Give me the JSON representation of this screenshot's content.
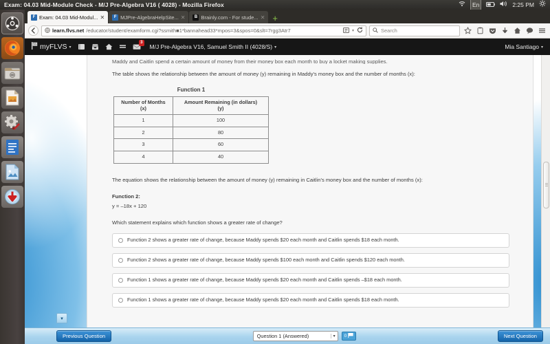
{
  "os": {
    "window_title": "Exam: 04.03 Mid-Module Check - M/J Pre-Algebra V16 ( 4028) - Mozilla Firefox",
    "tray": {
      "wifi_icon": "wifi-icon",
      "keyboard_layout": "En",
      "battery_icon": "battery-icon",
      "volume_icon": "volume-icon",
      "clock": "2:25 PM",
      "settings_icon": "gear-icon"
    },
    "launcher": [
      {
        "name": "ubuntu-dash-icon",
        "label": "Ubuntu Dash"
      },
      {
        "name": "firefox-icon",
        "label": "Firefox"
      },
      {
        "name": "files-icon",
        "label": "Files"
      },
      {
        "name": "impress-icon",
        "label": "LibreOffice Impress"
      },
      {
        "name": "system-settings-icon",
        "label": "System Settings"
      },
      {
        "name": "writer-icon",
        "label": "LibreOffice Writer"
      },
      {
        "name": "image-viewer-icon",
        "label": "Image Viewer"
      },
      {
        "name": "software-updater-icon",
        "label": "Software Updater"
      }
    ]
  },
  "browser": {
    "tabs": [
      {
        "title": "Exam: 04.03 Mid-Modul...",
        "favicon": "flvs",
        "active": true
      },
      {
        "title": "MJPre-AlgebraHelpSite...",
        "favicon": "flvs",
        "active": false
      },
      {
        "title": "Brainly.com - For stude...",
        "favicon": "brainly",
        "active": false
      }
    ],
    "new_tab_label": "+",
    "close_label": "✕",
    "url_host": "learn.flvs.net",
    "url_host_bold": "flvs.net",
    "url_path": "/educator/student/examform.cgi?ssmith■1*bannahead33*mpos=3&spos=0&slt=7rgg3Atr7",
    "search_placeholder": "Search",
    "toolbar_icons": [
      "bookmark-star-icon",
      "reader-clipboard-icon",
      "pocket-icon",
      "downloads-icon",
      "home-icon",
      "chat-icon",
      "menu-hamburger-icon"
    ]
  },
  "flvs": {
    "logo_text": "myFLVS",
    "nav_icons": [
      "book-icon",
      "inbox-icon",
      "home-icon",
      "list-icon",
      "mail-icon"
    ],
    "mail_badge": "3",
    "course_title": "M/J Pre-Algebra V16, Samuel Smith II (4028/S)",
    "user_name": "Mia Santiago",
    "caret": "▾"
  },
  "question": {
    "clipped_top_line": "Maddy and Caitlin spend a certain amount of money from their money box each month to buy a locket making supplies.",
    "table_intro": "The table shows the relationship between the amount of money (y) remaining in Maddy's money box and the number of months (x):",
    "equation_intro": "The equation shows the relationship between the amount of money (y) remaining in Caitlin's money box and the number of months (x):",
    "function2_label": "Function 2:",
    "function2_equation": "y = –18x + 120",
    "prompt": "Which statement explains which function shows a greater rate of change?",
    "choices": [
      "Function 2 shows a greater rate of change, because Maddy spends $20 each month and Caitlin spends $18 each month.",
      "Function 2 shows a greater rate of change, because Maddy spends $100 each month and Caitlin spends $120 each month.",
      "Function 1 shows a greater rate of change, because Maddy spends $20 each month and Caitlin spends –$18 each month.",
      "Function 1 shows a greater rate of change, because Maddy spends $20 each month and Caitlin spends $18 each month."
    ]
  },
  "table": {
    "caption": "Function 1",
    "headers": [
      "Number of Months (x)",
      "Amount Remaining (in dollars) (y)"
    ],
    "header_lines": [
      [
        "Number of Months",
        "(x)"
      ],
      [
        "Amount Remaining (in dollars)",
        "(y)"
      ]
    ],
    "rows": [
      [
        "1",
        "100"
      ],
      [
        "2",
        "80"
      ],
      [
        "3",
        "60"
      ],
      [
        "4",
        "40"
      ]
    ]
  },
  "footer": {
    "previous_label": "Previous Question",
    "next_label": "Next Question",
    "question_selector_value": "Question 1 (Answered)",
    "flag_count": "0",
    "flag_icon": "flag-icon",
    "rail_toggle_icon": "chevron-down-icon"
  },
  "colors": {
    "accent_blue": "#1463a8",
    "flvs_black": "#161616",
    "badge_red": "#cc2222",
    "page_blue": "#2f8fd0"
  }
}
